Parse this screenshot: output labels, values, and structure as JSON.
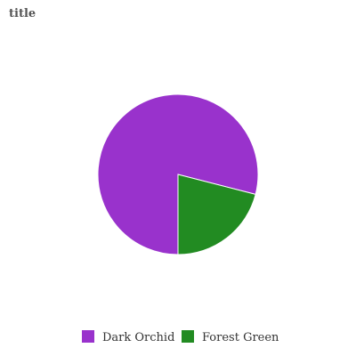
{
  "chart_data": {
    "type": "pie",
    "title": "title",
    "slices": [
      {
        "label": "Dark Orchid",
        "value": 79,
        "color": "#9932CC"
      },
      {
        "label": "Forest Green",
        "value": 21,
        "color": "#228B22"
      }
    ],
    "legend_position": "bottom"
  }
}
